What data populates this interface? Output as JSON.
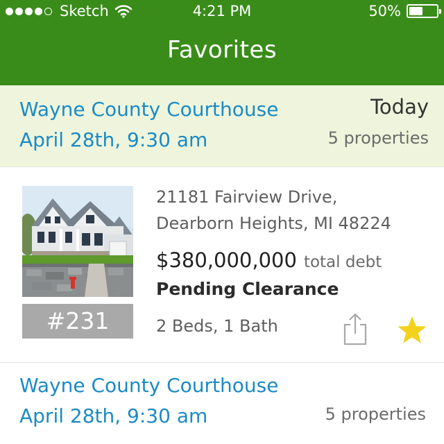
{
  "status_bar": {
    "carrier": "Sketch",
    "time": "4:21 PM",
    "battery_percent": "50%",
    "battery_level": 0.5,
    "signal_bars_filled": 4,
    "signal_bars_total": 5
  },
  "nav": {
    "title": "Favorites"
  },
  "events": [
    {
      "name": "Wayne County Courthouse",
      "date": "April 28th, 9:30 am",
      "day": "Today",
      "count": "5 properties"
    },
    {
      "name": "Wayne County Courthouse",
      "date": "April 28th, 9:30 am",
      "count": "5 properties"
    }
  ],
  "property": {
    "lot": "#231",
    "address_line1": "21181 Fairview Drive,",
    "address_line2": "Dearborn Heights, MI 48224",
    "price": "$380,000,000",
    "price_label": "total debt",
    "status": "Pending Clearance",
    "beds_baths": "2 Beds, 1 Bath",
    "favorited": true
  },
  "colors": {
    "header_green": "#3a8c1a",
    "link_blue": "#1b8ac6",
    "highlight_bg": "#eef5dc",
    "star_yellow": "#f2d21b",
    "badge_gray": "#a9a9a9"
  },
  "icons": [
    "wifi-icon",
    "battery-icon",
    "share-icon",
    "star-icon"
  ]
}
